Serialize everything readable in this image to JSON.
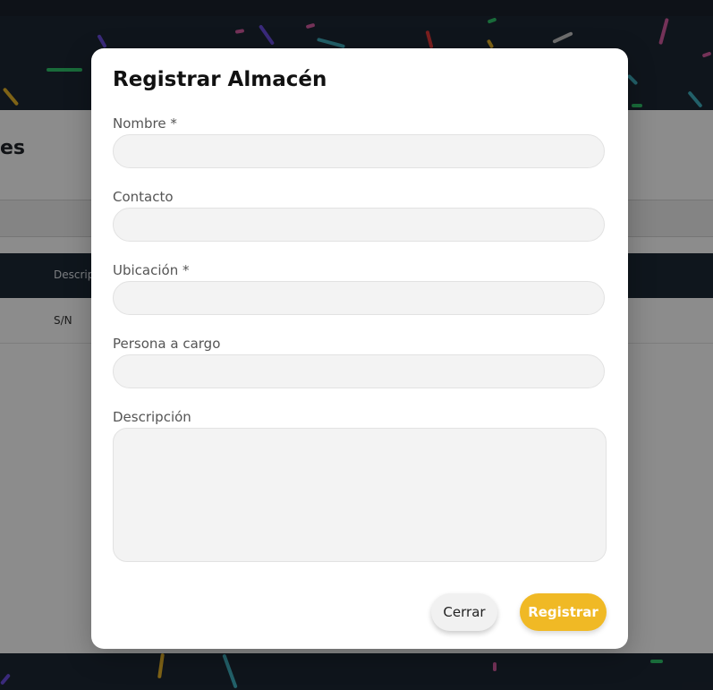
{
  "background_page": {
    "heading_fragment": "es",
    "table_header_fragment": "Descrip",
    "row_value": "S/N"
  },
  "modal": {
    "title": "Registrar Almacén",
    "fields": [
      {
        "label": "Nombre *",
        "value": ""
      },
      {
        "label": "Contacto",
        "value": ""
      },
      {
        "label": "Ubicación *",
        "value": ""
      },
      {
        "label": "Persona a cargo",
        "value": ""
      },
      {
        "label": "Descripción",
        "value": ""
      }
    ],
    "buttons": {
      "close_label": "Cerrar",
      "submit_label": "Registrar"
    }
  },
  "colors": {
    "accent": "#f0b925",
    "header_dark": "#1d2836",
    "overlay": "rgba(0,0,0,0.45)"
  }
}
